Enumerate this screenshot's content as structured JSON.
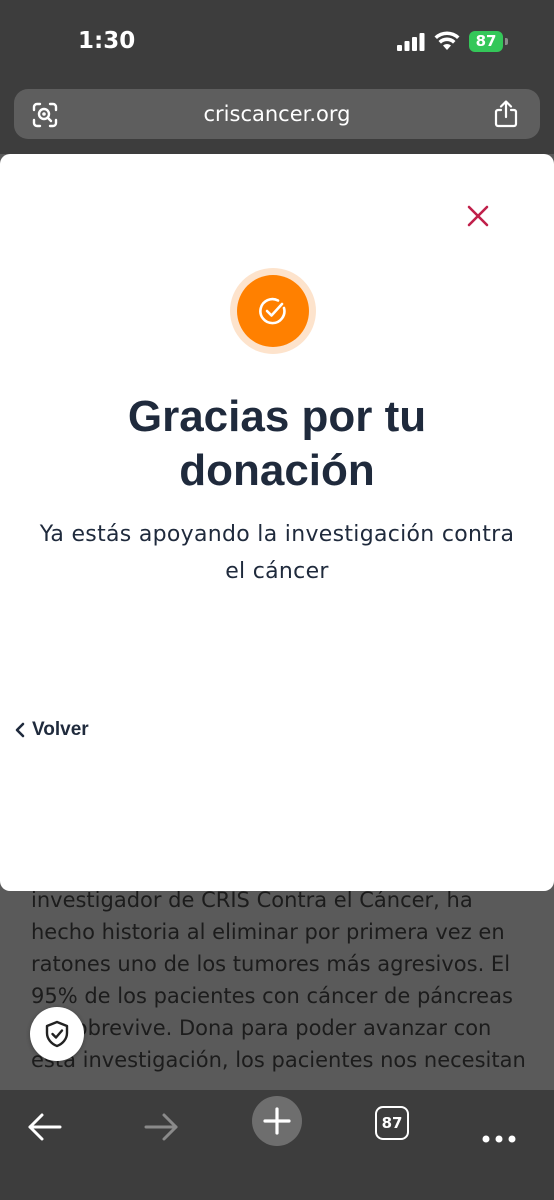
{
  "status_bar": {
    "time": "1:30",
    "battery": "87"
  },
  "address_bar": {
    "url": "criscancer.org"
  },
  "modal": {
    "title": "Gracias por tu donación",
    "subtitle": "Ya estás apoyando la investigación contra el cáncer",
    "back_label": "Volver"
  },
  "article": {
    "lines": [
      "investigador de CRIS Contra el Cáncer, ha",
      "hecho historia al eliminar por primera vez en",
      "ratones uno de los tumores más agresivos. El",
      "95% de los pacientes con cáncer de páncreas",
      "no sobrevive. Dona para poder avanzar con",
      "esta investigación, los pacientes nos necesitan"
    ]
  },
  "toolbar": {
    "tab_count": "87"
  },
  "colors": {
    "accent_orange": "#ff8000",
    "close_red": "#c0204a",
    "title_navy": "#1f2a3c"
  }
}
